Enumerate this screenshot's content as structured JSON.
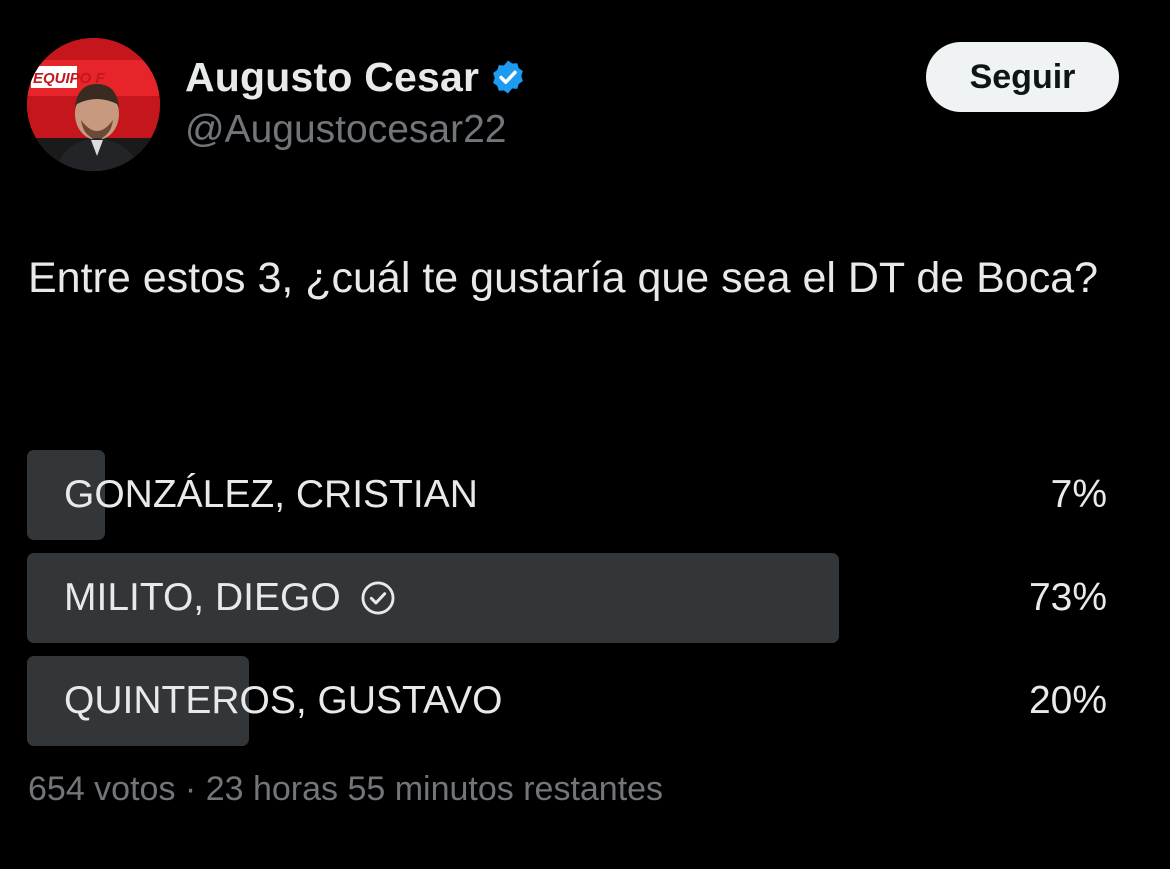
{
  "author": {
    "display_name": "Augusto Cesar",
    "handle": "@Augustocesar22",
    "verified": true,
    "verified_icon": "verified-badge-icon",
    "avatar_text": "EQUIPO F"
  },
  "follow_label": "Seguir",
  "tweet": {
    "text": "Entre estos 3, ¿cuál te gustaría que sea el DT de Boca?"
  },
  "poll": {
    "options": [
      {
        "label": "GONZÁLEZ, CRISTIAN",
        "percent": "7%",
        "value": 0.07,
        "winner": false
      },
      {
        "label": "MILITO, DIEGO",
        "percent": "73%",
        "value": 0.73,
        "winner": true
      },
      {
        "label": "QUINTEROS, GUSTAVO",
        "percent": "20%",
        "value": 0.2,
        "winner": false
      }
    ],
    "votes": "654 votos",
    "separator": "·",
    "time_left": "23 horas 55 minutos restantes"
  },
  "colors": {
    "background": "#000000",
    "text": "#e7e9ea",
    "secondary_text": "#71767b",
    "poll_bar": "#333639",
    "verified": "#1d9bf0",
    "button_bg": "#eff3f4"
  }
}
